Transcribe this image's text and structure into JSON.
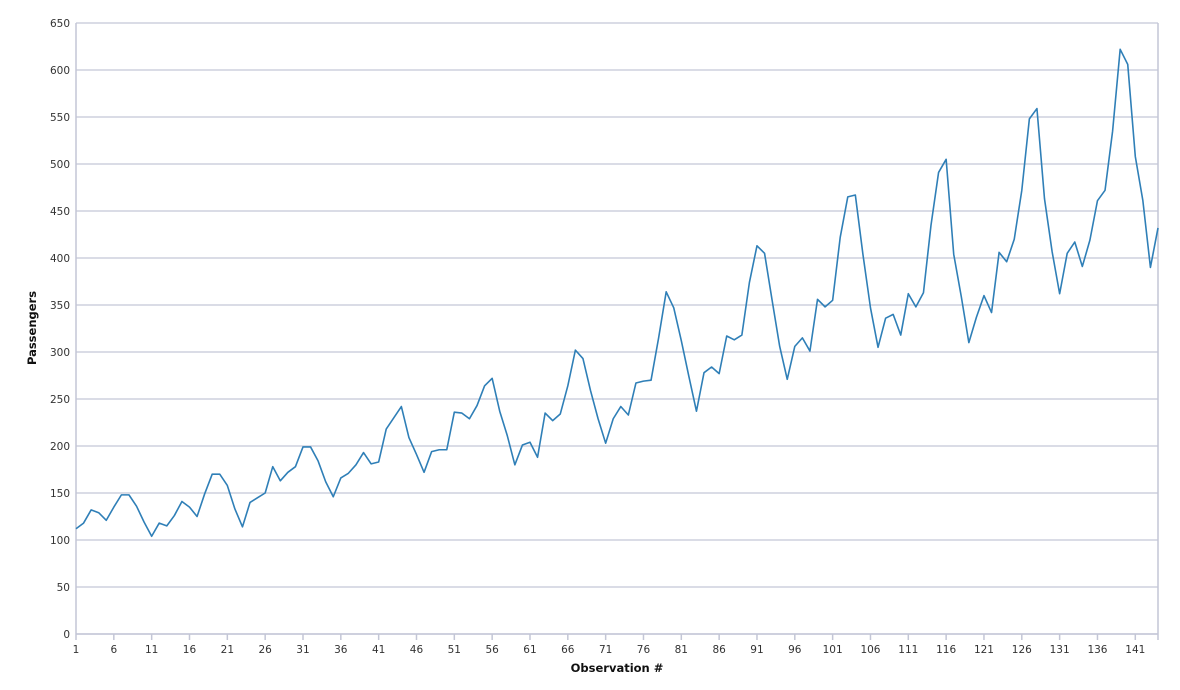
{
  "chart_data": {
    "type": "line",
    "title": "",
    "xlabel": "Observation #",
    "ylabel": "Passengers",
    "xlim": [
      1,
      144
    ],
    "ylim": [
      0,
      650
    ],
    "grid": true,
    "legend": "none",
    "x_ticks": [
      1,
      6,
      11,
      16,
      21,
      26,
      31,
      36,
      41,
      46,
      51,
      56,
      61,
      66,
      71,
      76,
      81,
      86,
      91,
      96,
      101,
      106,
      111,
      116,
      121,
      126,
      131,
      136,
      141
    ],
    "y_ticks": [
      0,
      50,
      100,
      150,
      200,
      250,
      300,
      350,
      400,
      450,
      500,
      550,
      600,
      650
    ],
    "series": [
      {
        "name": "Passengers",
        "color": "#2f7fb7",
        "values": [
          112,
          118,
          132,
          129,
          121,
          135,
          148,
          148,
          136,
          119,
          104,
          118,
          115,
          126,
          141,
          135,
          125,
          149,
          170,
          170,
          158,
          133,
          114,
          140,
          145,
          150,
          178,
          163,
          172,
          178,
          199,
          199,
          184,
          162,
          146,
          166,
          171,
          180,
          193,
          181,
          183,
          218,
          230,
          242,
          209,
          191,
          172,
          194,
          196,
          196,
          236,
          235,
          229,
          243,
          264,
          272,
          237,
          211,
          180,
          201,
          204,
          188,
          235,
          227,
          234,
          264,
          302,
          293,
          259,
          229,
          203,
          229,
          242,
          233,
          267,
          269,
          270,
          315,
          364,
          347,
          312,
          274,
          237,
          278,
          284,
          277,
          317,
          313,
          318,
          374,
          413,
          405,
          355,
          306,
          271,
          306,
          315,
          301,
          356,
          348,
          355,
          422,
          465,
          467,
          404,
          347,
          305,
          336,
          340,
          318,
          362,
          348,
          363,
          435,
          491,
          505,
          404,
          359,
          310,
          337,
          360,
          342,
          406,
          396,
          420,
          472,
          548,
          559,
          463,
          407,
          362,
          405,
          417,
          391,
          419,
          461,
          472,
          535,
          622,
          606,
          508,
          461,
          390,
          432
        ]
      }
    ]
  }
}
